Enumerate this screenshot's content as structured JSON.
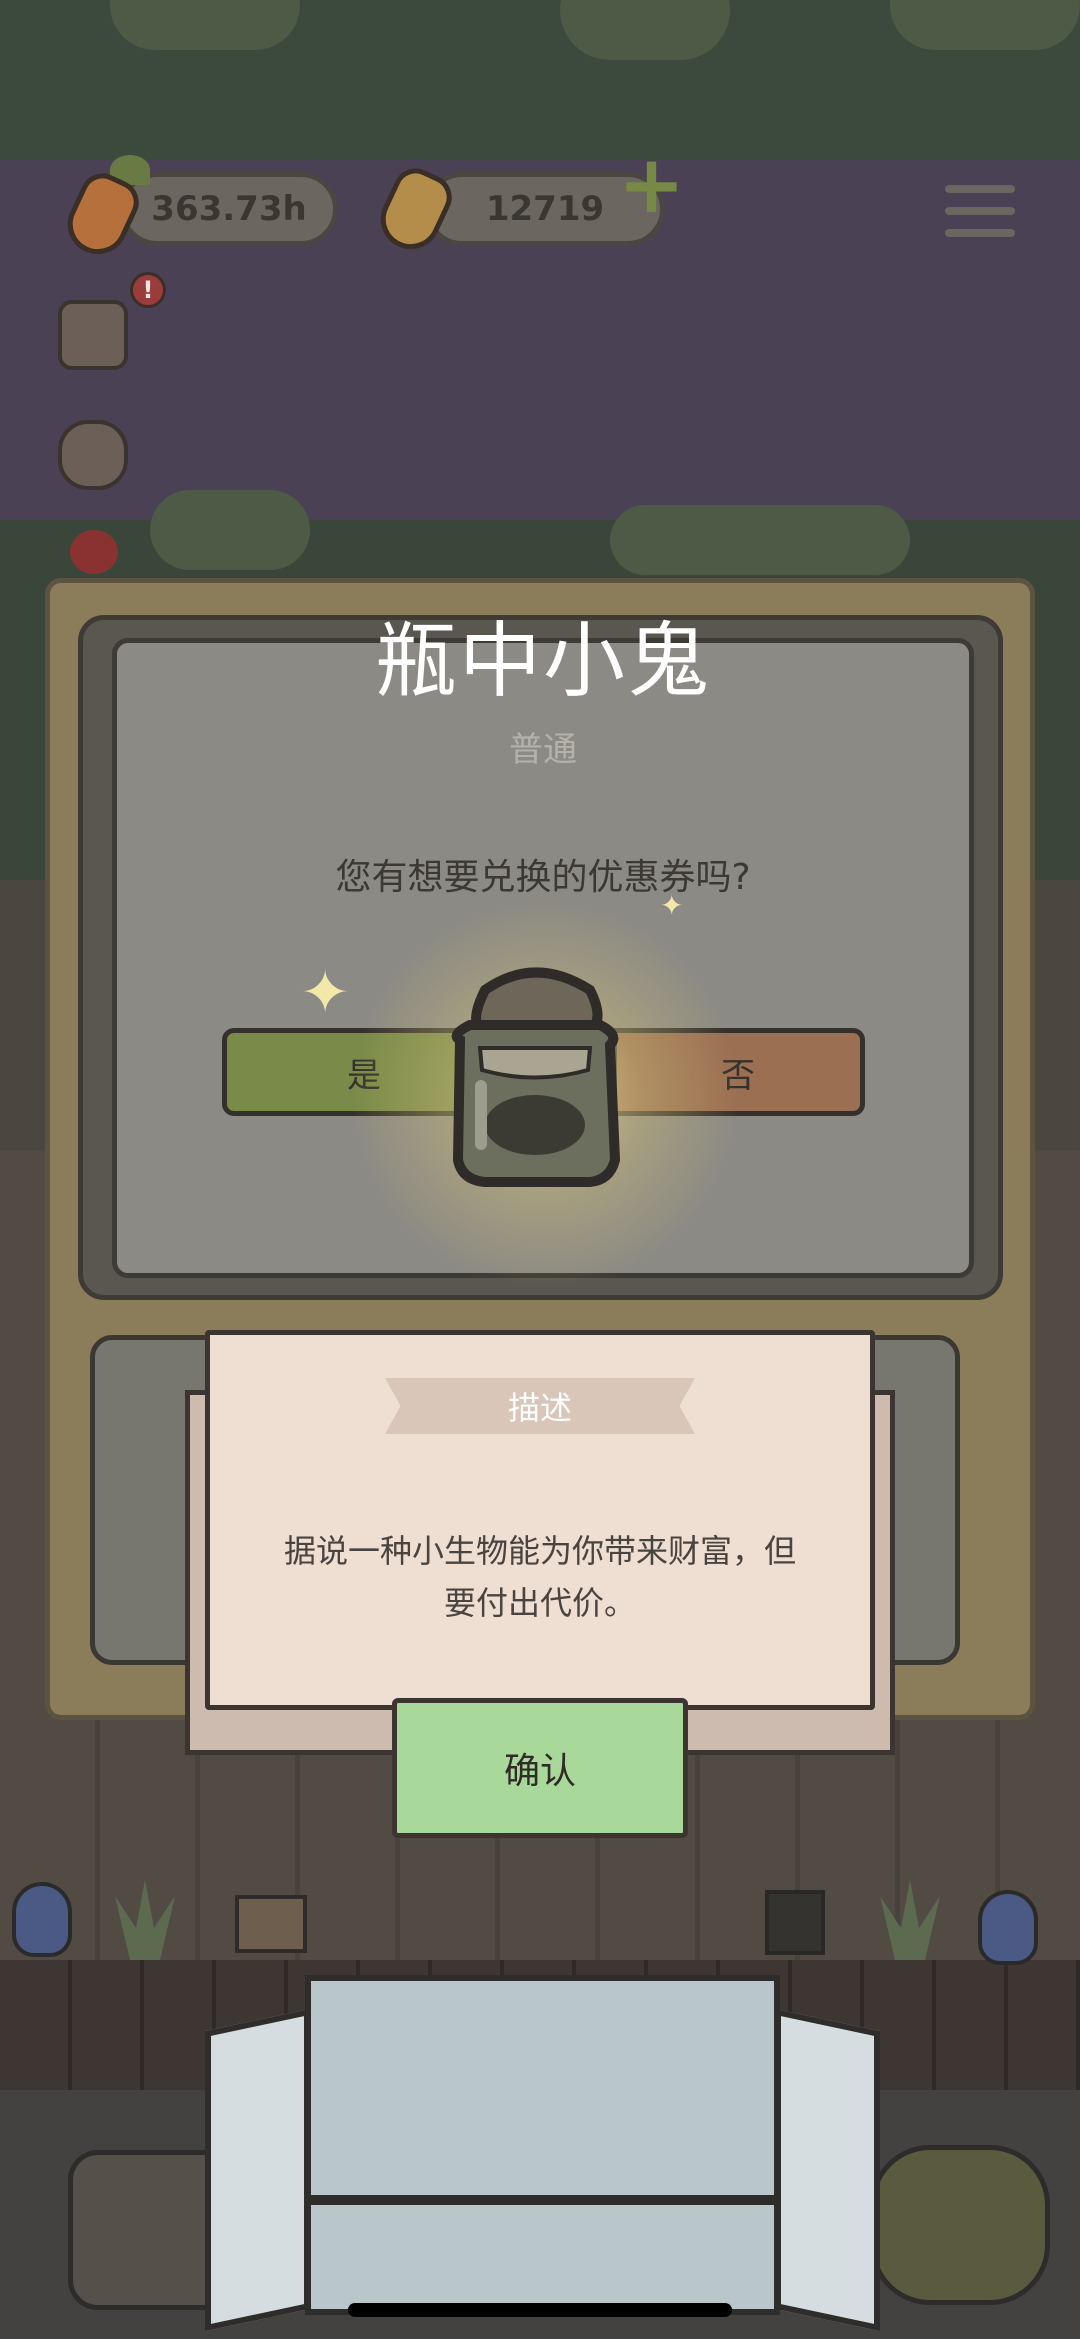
{
  "hud": {
    "carrot_time": "363.73h",
    "gold_carrots": "12719",
    "alert_mark": "!"
  },
  "dialog": {
    "title": "瓶中小鬼",
    "rarity": "普通",
    "question": "您有想要兑换的优惠券吗?",
    "yes_label": "是",
    "no_label": "否"
  },
  "description": {
    "header": "描述",
    "text_line1": "据说一种小生物能为你带来财富，但",
    "text_line2": "要付出代价。",
    "confirm_label": "确认"
  },
  "colors": {
    "yes_button": "#7a8a48",
    "no_button": "#9b6f52",
    "confirm_button": "#a9d99a",
    "card": "#efdfd3"
  }
}
